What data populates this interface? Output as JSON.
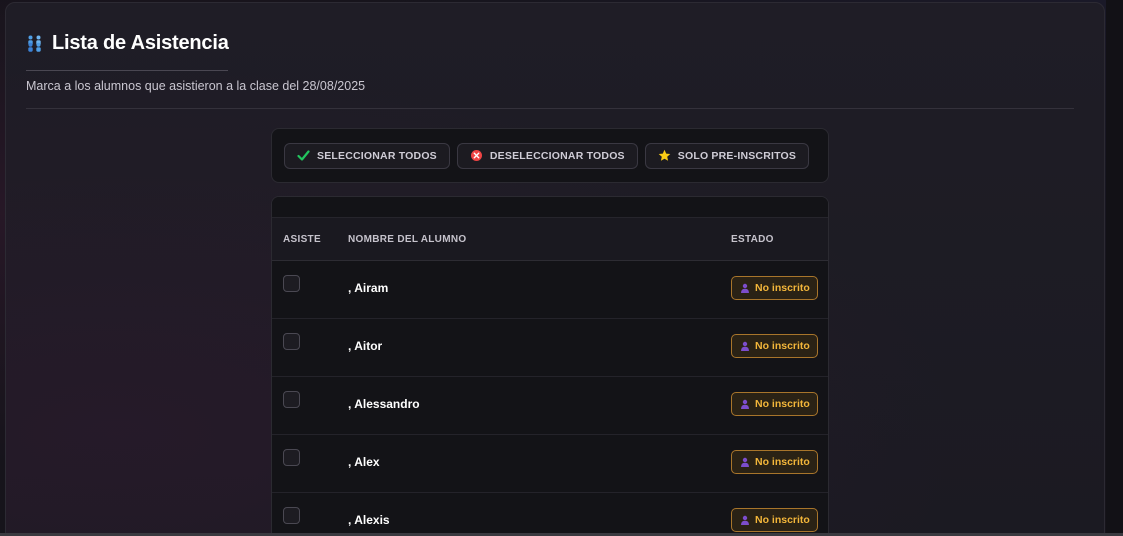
{
  "header": {
    "title": "Lista de Asistencia",
    "subtitle": "Marca a los alumnos que asistieron a la clase del 28/08/2025",
    "title_icon": "people-icon"
  },
  "actions": {
    "select_all": "SELECCIONAR TODOS",
    "deselect_all": "DESELECCIONAR TODOS",
    "only_preregistered": "SOLO PRE-INSCRITOS"
  },
  "table": {
    "columns": {
      "attends": "ASISTE",
      "student_name": "NOMBRE DEL ALUMNO",
      "status": "ESTADO"
    },
    "rows": [
      {
        "name": ", Airam",
        "status": "No inscrito",
        "checked": false
      },
      {
        "name": ", Aitor",
        "status": "No inscrito",
        "checked": false
      },
      {
        "name": ", Alessandro",
        "status": "No inscrito",
        "checked": false
      },
      {
        "name": ", Alex",
        "status": "No inscrito",
        "checked": false
      },
      {
        "name": ", Alexis",
        "status": "No inscrito",
        "checked": false
      }
    ]
  },
  "colors": {
    "accent_green": "#22c55e",
    "accent_red": "#ef4444",
    "accent_yellow": "#facc15",
    "badge_text": "#f3b63a",
    "badge_icon": "#7c4dcc"
  }
}
